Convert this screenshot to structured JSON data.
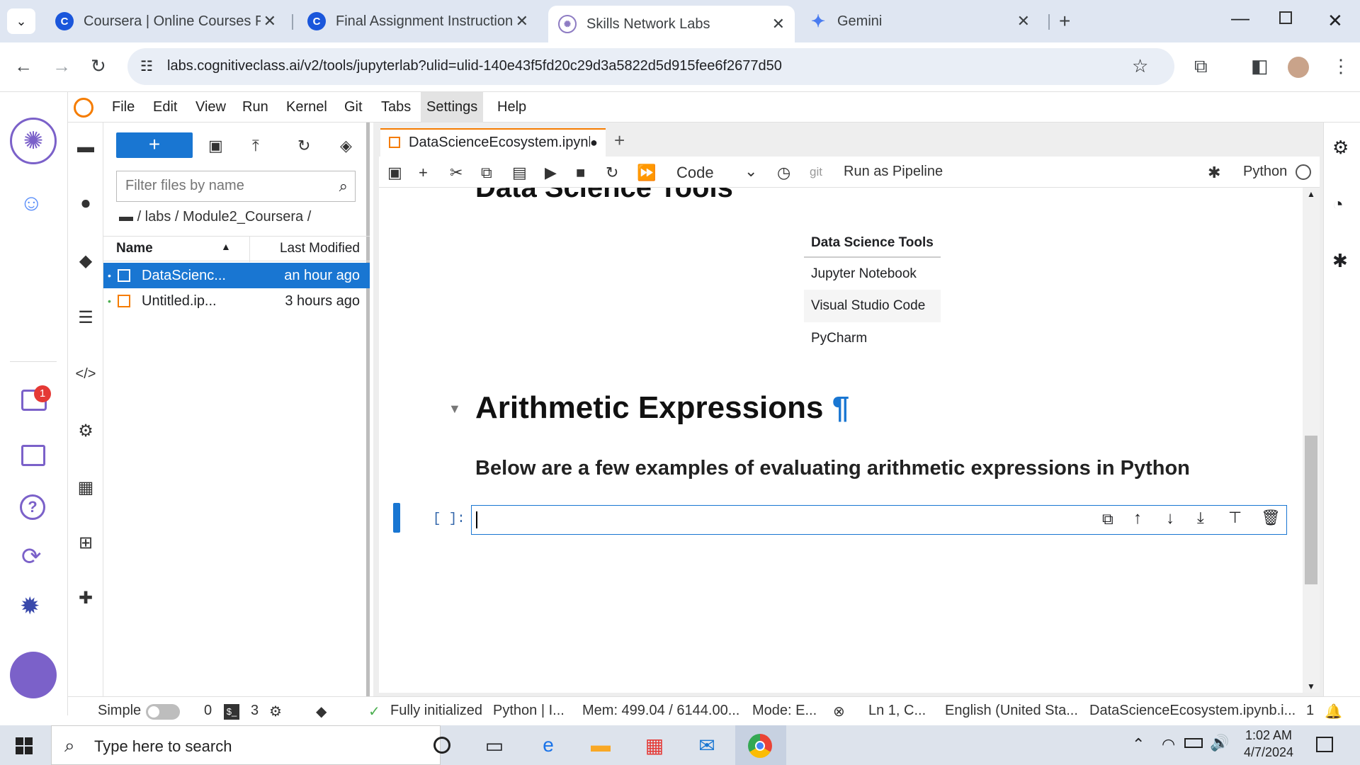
{
  "browser": {
    "tabs": [
      {
        "title": "Coursera | Online Courses From",
        "favicon": "coursera-icon"
      },
      {
        "title": "Final Assignment Instructions: C",
        "favicon": "coursera-icon"
      },
      {
        "title": "Skills Network Labs",
        "favicon": "skills-network-icon"
      },
      {
        "title": "Gemini",
        "favicon": "gemini-icon"
      }
    ],
    "url": "labs.cognitiveclass.ai/v2/tools/jupyterlab?ulid=ulid-140e43f5fd20c29d3a5822d5d915fee6f2677d50"
  },
  "menu": [
    "File",
    "Edit",
    "View",
    "Run",
    "Kernel",
    "Git",
    "Tabs",
    "Settings",
    "Help"
  ],
  "filebrowser": {
    "filter_placeholder": "Filter files by name",
    "breadcrumb": "/ labs / Module2_Coursera /",
    "col_name": "Name",
    "col_modified": "Last Modified",
    "files": [
      {
        "name": "DataScienc...",
        "modified": "an hour ago"
      },
      {
        "name": "Untitled.ip...",
        "modified": "3 hours ago"
      }
    ]
  },
  "notebook": {
    "tab_title": "DataScienceEcosystem.ipynb",
    "cell_type": "Code",
    "git_label": "git",
    "pipeline_label": "Run as Pipeline",
    "kernel": "Python",
    "heading_partial": "Data Science Tools",
    "table_header": "Data Science Tools",
    "table_rows": [
      "Jupyter Notebook",
      "Visual Studio Code",
      "PyCharm"
    ],
    "section_heading": "Arithmetic Expressions",
    "anchor": "¶",
    "section_text": "Below are a few examples of evaluating arithmetic expressions in Python",
    "prompt": "[ ]:"
  },
  "statusbar": {
    "mode_label": "Simple",
    "terminals": "0",
    "kernels": "3",
    "kernel_status": "Fully initialized",
    "kernel_name": "Python | I...",
    "mem": "Mem: 499.04 / 6144.00...",
    "mode": "Mode: E...",
    "position": "Ln 1, C...",
    "language": "English (United Sta...",
    "file": "DataScienceEcosystem.ipynb.i...",
    "notifications": "1"
  },
  "rail": {
    "inbox_badge": "1"
  },
  "taskbar": {
    "search_placeholder": "Type here to search",
    "time": "1:02 AM",
    "date": "4/7/2024"
  },
  "colors": {
    "accent": "#1976d2",
    "tab_bg": "#dfe6f2",
    "taskbar": "#dde3ec"
  }
}
